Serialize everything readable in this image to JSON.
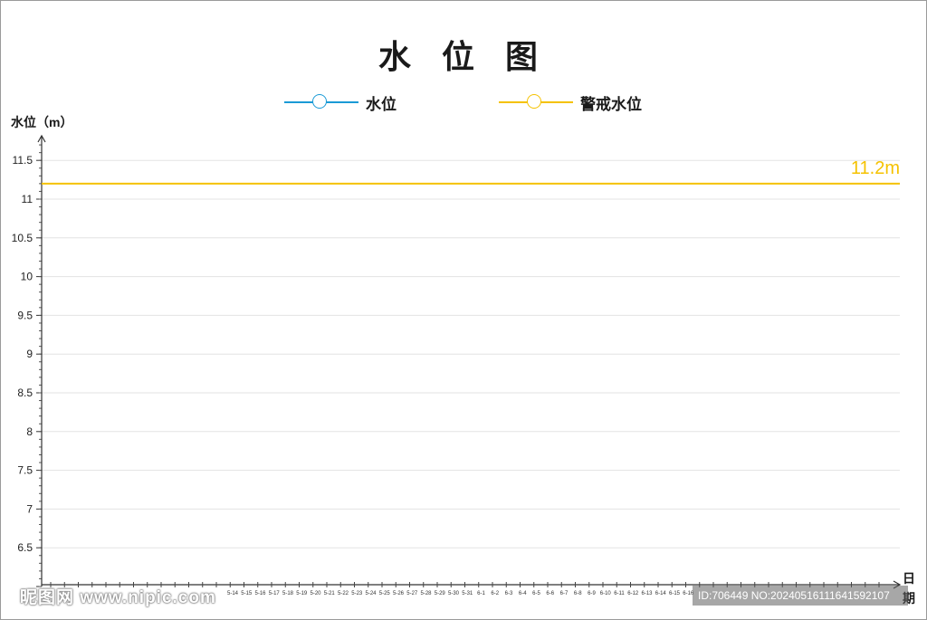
{
  "chart_data": {
    "type": "line",
    "title": "水 位 图",
    "ylabel": "水位（m）",
    "xlabel": "日期",
    "ylim": [
      6,
      12
    ],
    "yticks": [
      "6",
      "6.5",
      "7",
      "7.5",
      "8",
      "8.5",
      "9",
      "9.5",
      "10",
      "10.5",
      "11",
      "11.5"
    ],
    "minor_ticks_per_major": 5,
    "grid": true,
    "legend_position": "top-center",
    "x": [
      "5-14",
      "5-15",
      "5-16",
      "5-17",
      "5-18",
      "5-19",
      "5-20",
      "5-21",
      "5-22",
      "5-23",
      "5-24",
      "5-25",
      "5-26",
      "5-27",
      "5-28",
      "5-29",
      "5-30",
      "5-31",
      "6-1",
      "6-2",
      "6-3",
      "6-4",
      "6-5",
      "6-6",
      "6-7",
      "6-8",
      "6-9",
      "6-10",
      "6-11",
      "6-12",
      "6-13",
      "6-14",
      "6-15",
      "6-16"
    ],
    "series": [
      {
        "name": "水位",
        "color": "#1a9ad6",
        "values": []
      },
      {
        "name": "警戒水位",
        "color": "#f5c200",
        "constant": 11.2,
        "label": "11.2m"
      }
    ]
  },
  "watermark": {
    "left_text": "昵图网 www.nipic.com",
    "right_text": "ID:706449 NO:20240516111641592107"
  }
}
